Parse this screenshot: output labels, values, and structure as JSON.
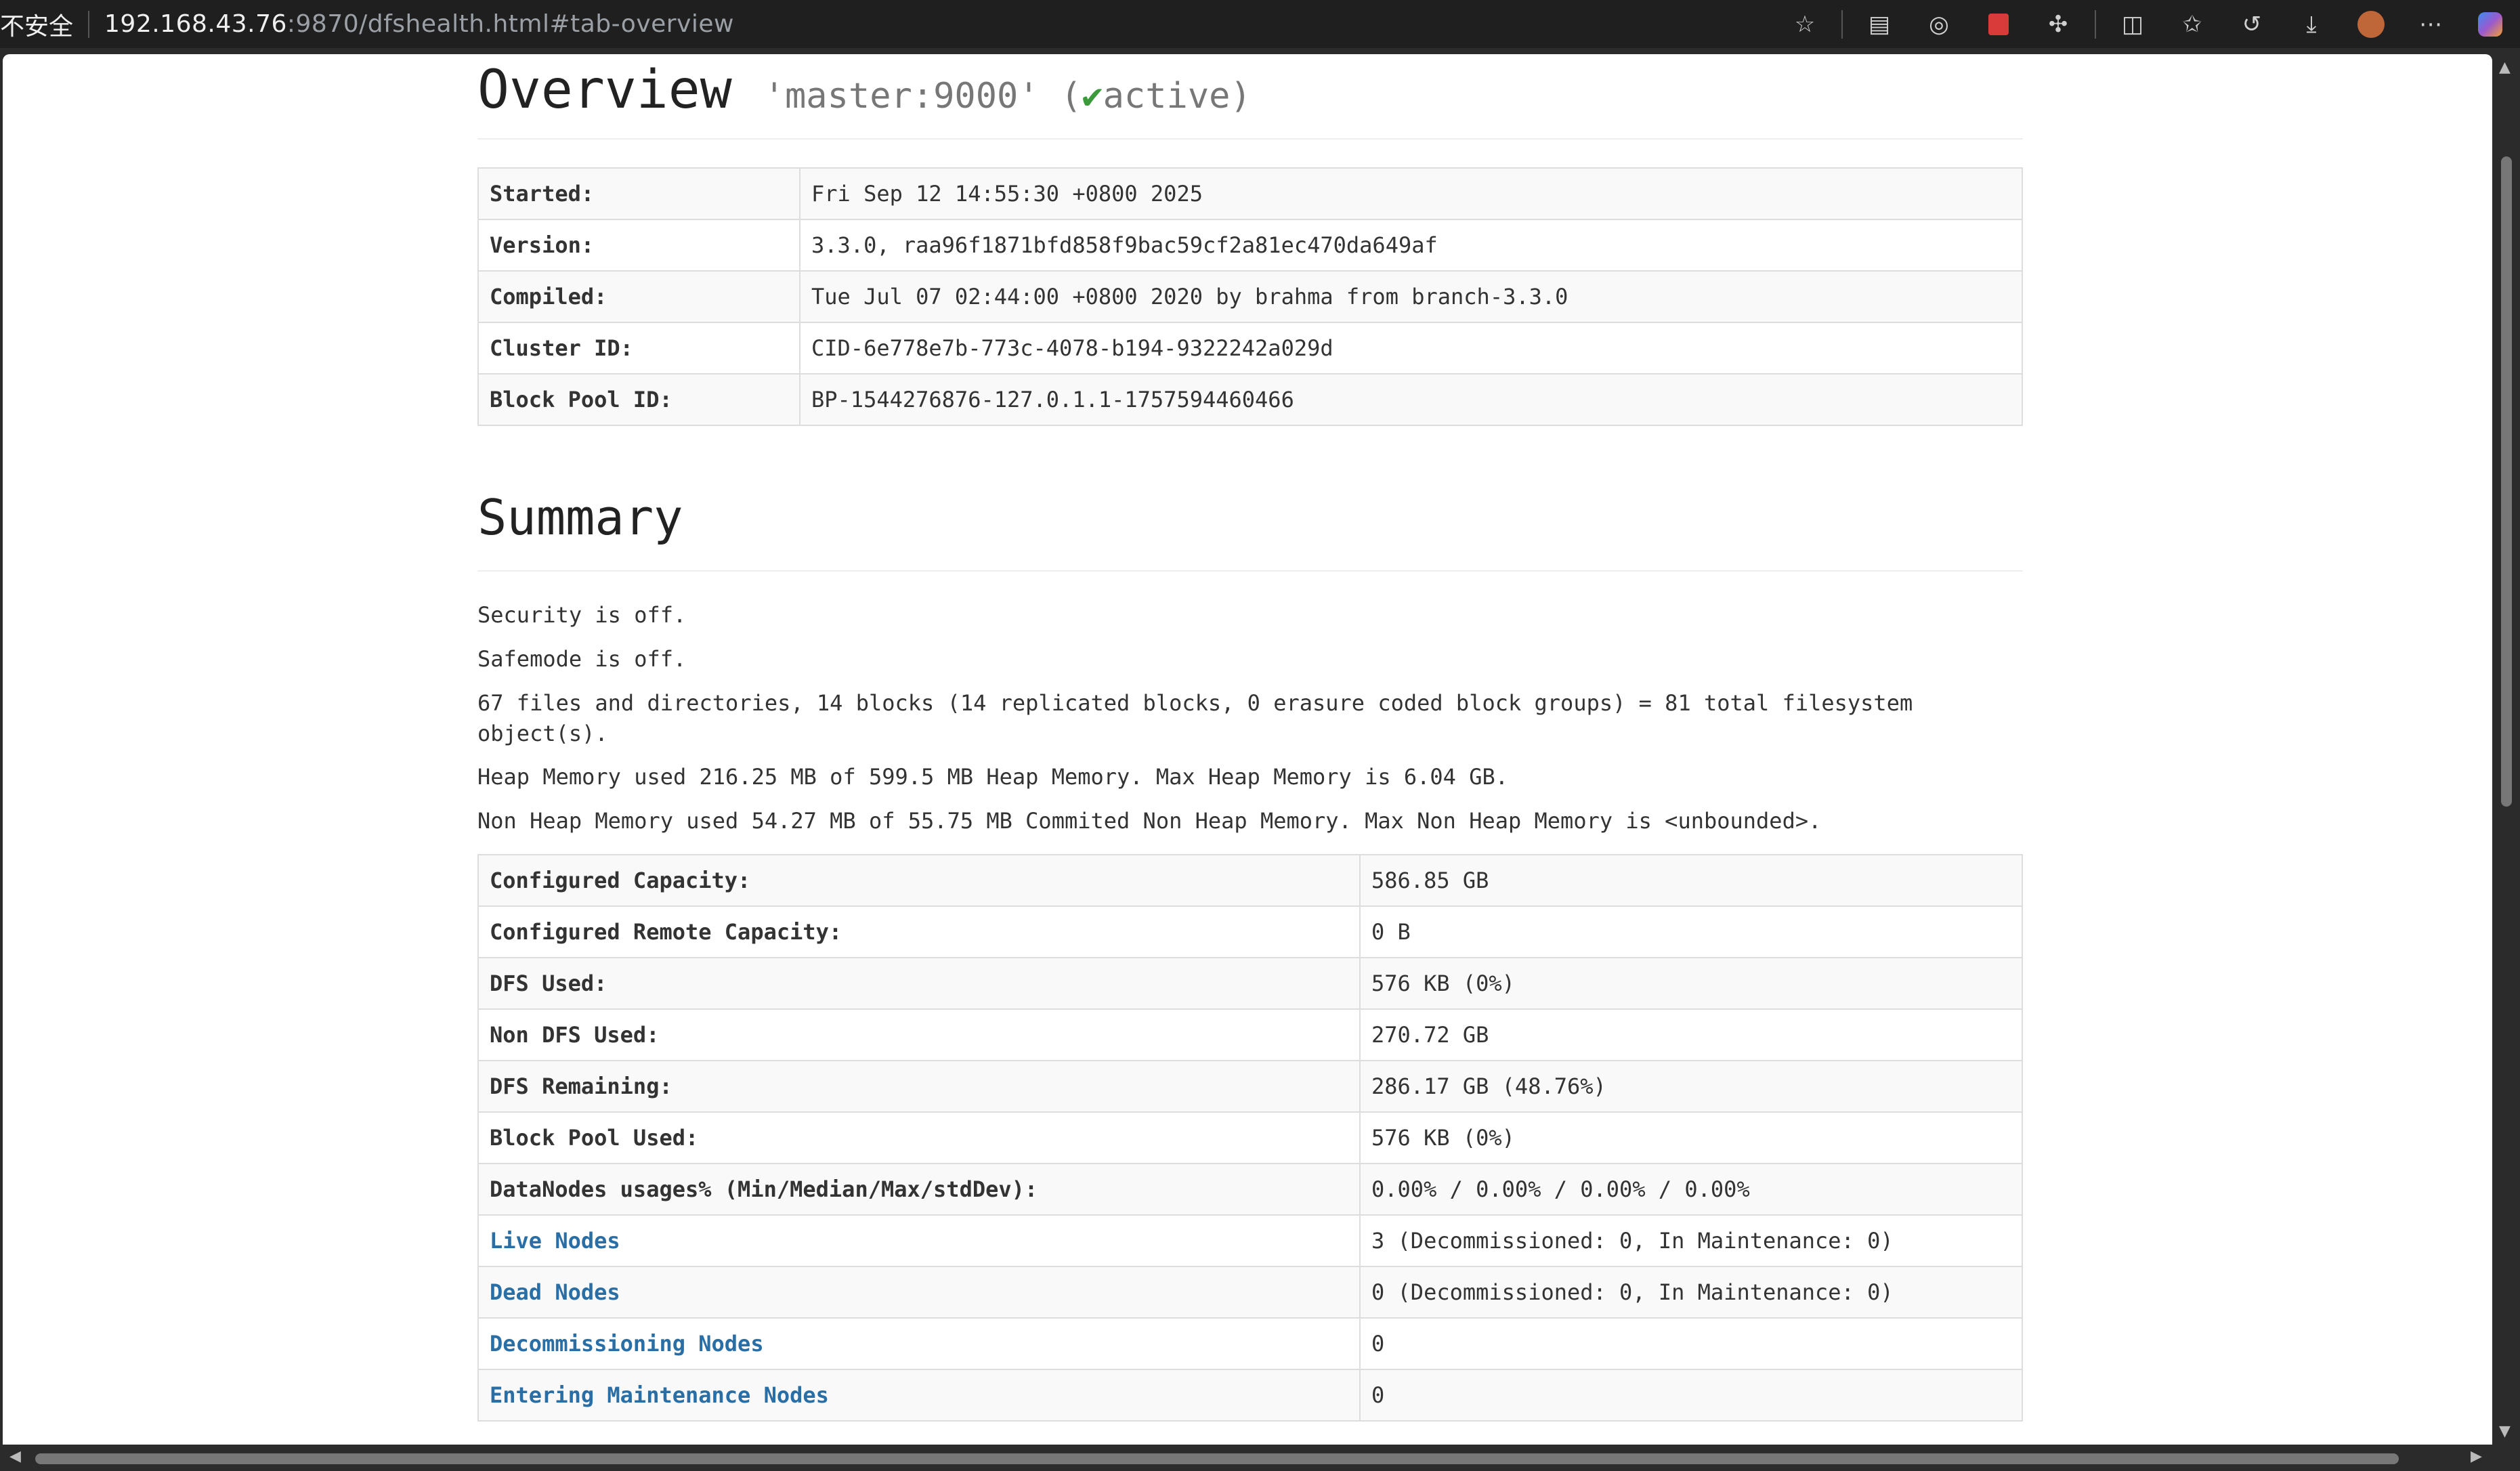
{
  "browser": {
    "insecure_label": "不安全",
    "url_host": "192.168.43.76",
    "url_rest": ":9870/dfshealth.html#tab-overview",
    "icons": [
      "star-icon",
      "tab-collections-icon",
      "reading-icon",
      "extension-red-icon",
      "puzzle-icon",
      "split-screen-icon",
      "favorites-icon",
      "history-icon",
      "download-icon",
      "profile-avatar",
      "more-icon",
      "copilot-icon"
    ]
  },
  "overview": {
    "title": "Overview",
    "host": "'master:9000'",
    "state_prefix": "(",
    "state_check": "✔",
    "state_text": "active)",
    "rows": [
      {
        "key": "Started:",
        "value": "Fri Sep 12 14:55:30 +0800 2025"
      },
      {
        "key": "Version:",
        "value": "3.3.0, raa96f1871bfd858f9bac59cf2a81ec470da649af"
      },
      {
        "key": "Compiled:",
        "value": "Tue Jul 07 02:44:00 +0800 2020 by brahma from branch-3.3.0"
      },
      {
        "key": "Cluster ID:",
        "value": "CID-6e778e7b-773c-4078-b194-9322242a029d"
      },
      {
        "key": "Block Pool ID:",
        "value": "BP-1544276876-127.0.1.1-1757594460466"
      }
    ]
  },
  "summary": {
    "title": "Summary",
    "lines": [
      "Security is off.",
      "Safemode is off.",
      "67 files and directories, 14 blocks (14 replicated blocks, 0 erasure coded block groups) = 81 total filesystem object(s).",
      "Heap Memory used 216.25 MB of 599.5 MB Heap Memory. Max Heap Memory is 6.04 GB.",
      "Non Heap Memory used 54.27 MB of 55.75 MB Commited Non Heap Memory. Max Non Heap Memory is <unbounded>."
    ],
    "rows": [
      {
        "key": "Configured Capacity:",
        "value": "586.85 GB"
      },
      {
        "key": "Configured Remote Capacity:",
        "value": "0 B"
      },
      {
        "key": "DFS Used:",
        "value": "576 KB (0%)"
      },
      {
        "key": "Non DFS Used:",
        "value": "270.72 GB"
      },
      {
        "key": "DFS Remaining:",
        "value": "286.17 GB (48.76%)"
      },
      {
        "key": "Block Pool Used:",
        "value": "576 KB (0%)"
      },
      {
        "key": "DataNodes usages% (Min/Median/Max/stdDev):",
        "value": "0.00% / 0.00% / 0.00% / 0.00%"
      },
      {
        "key": "Live Nodes",
        "value": "3 (Decommissioned: 0, In Maintenance: 0)"
      },
      {
        "key": "Dead Nodes",
        "value": "0 (Decommissioned: 0, In Maintenance: 0)"
      },
      {
        "key": "Decommissioning Nodes",
        "value": "0"
      },
      {
        "key": "Entering Maintenance Nodes",
        "value": "0"
      }
    ]
  }
}
